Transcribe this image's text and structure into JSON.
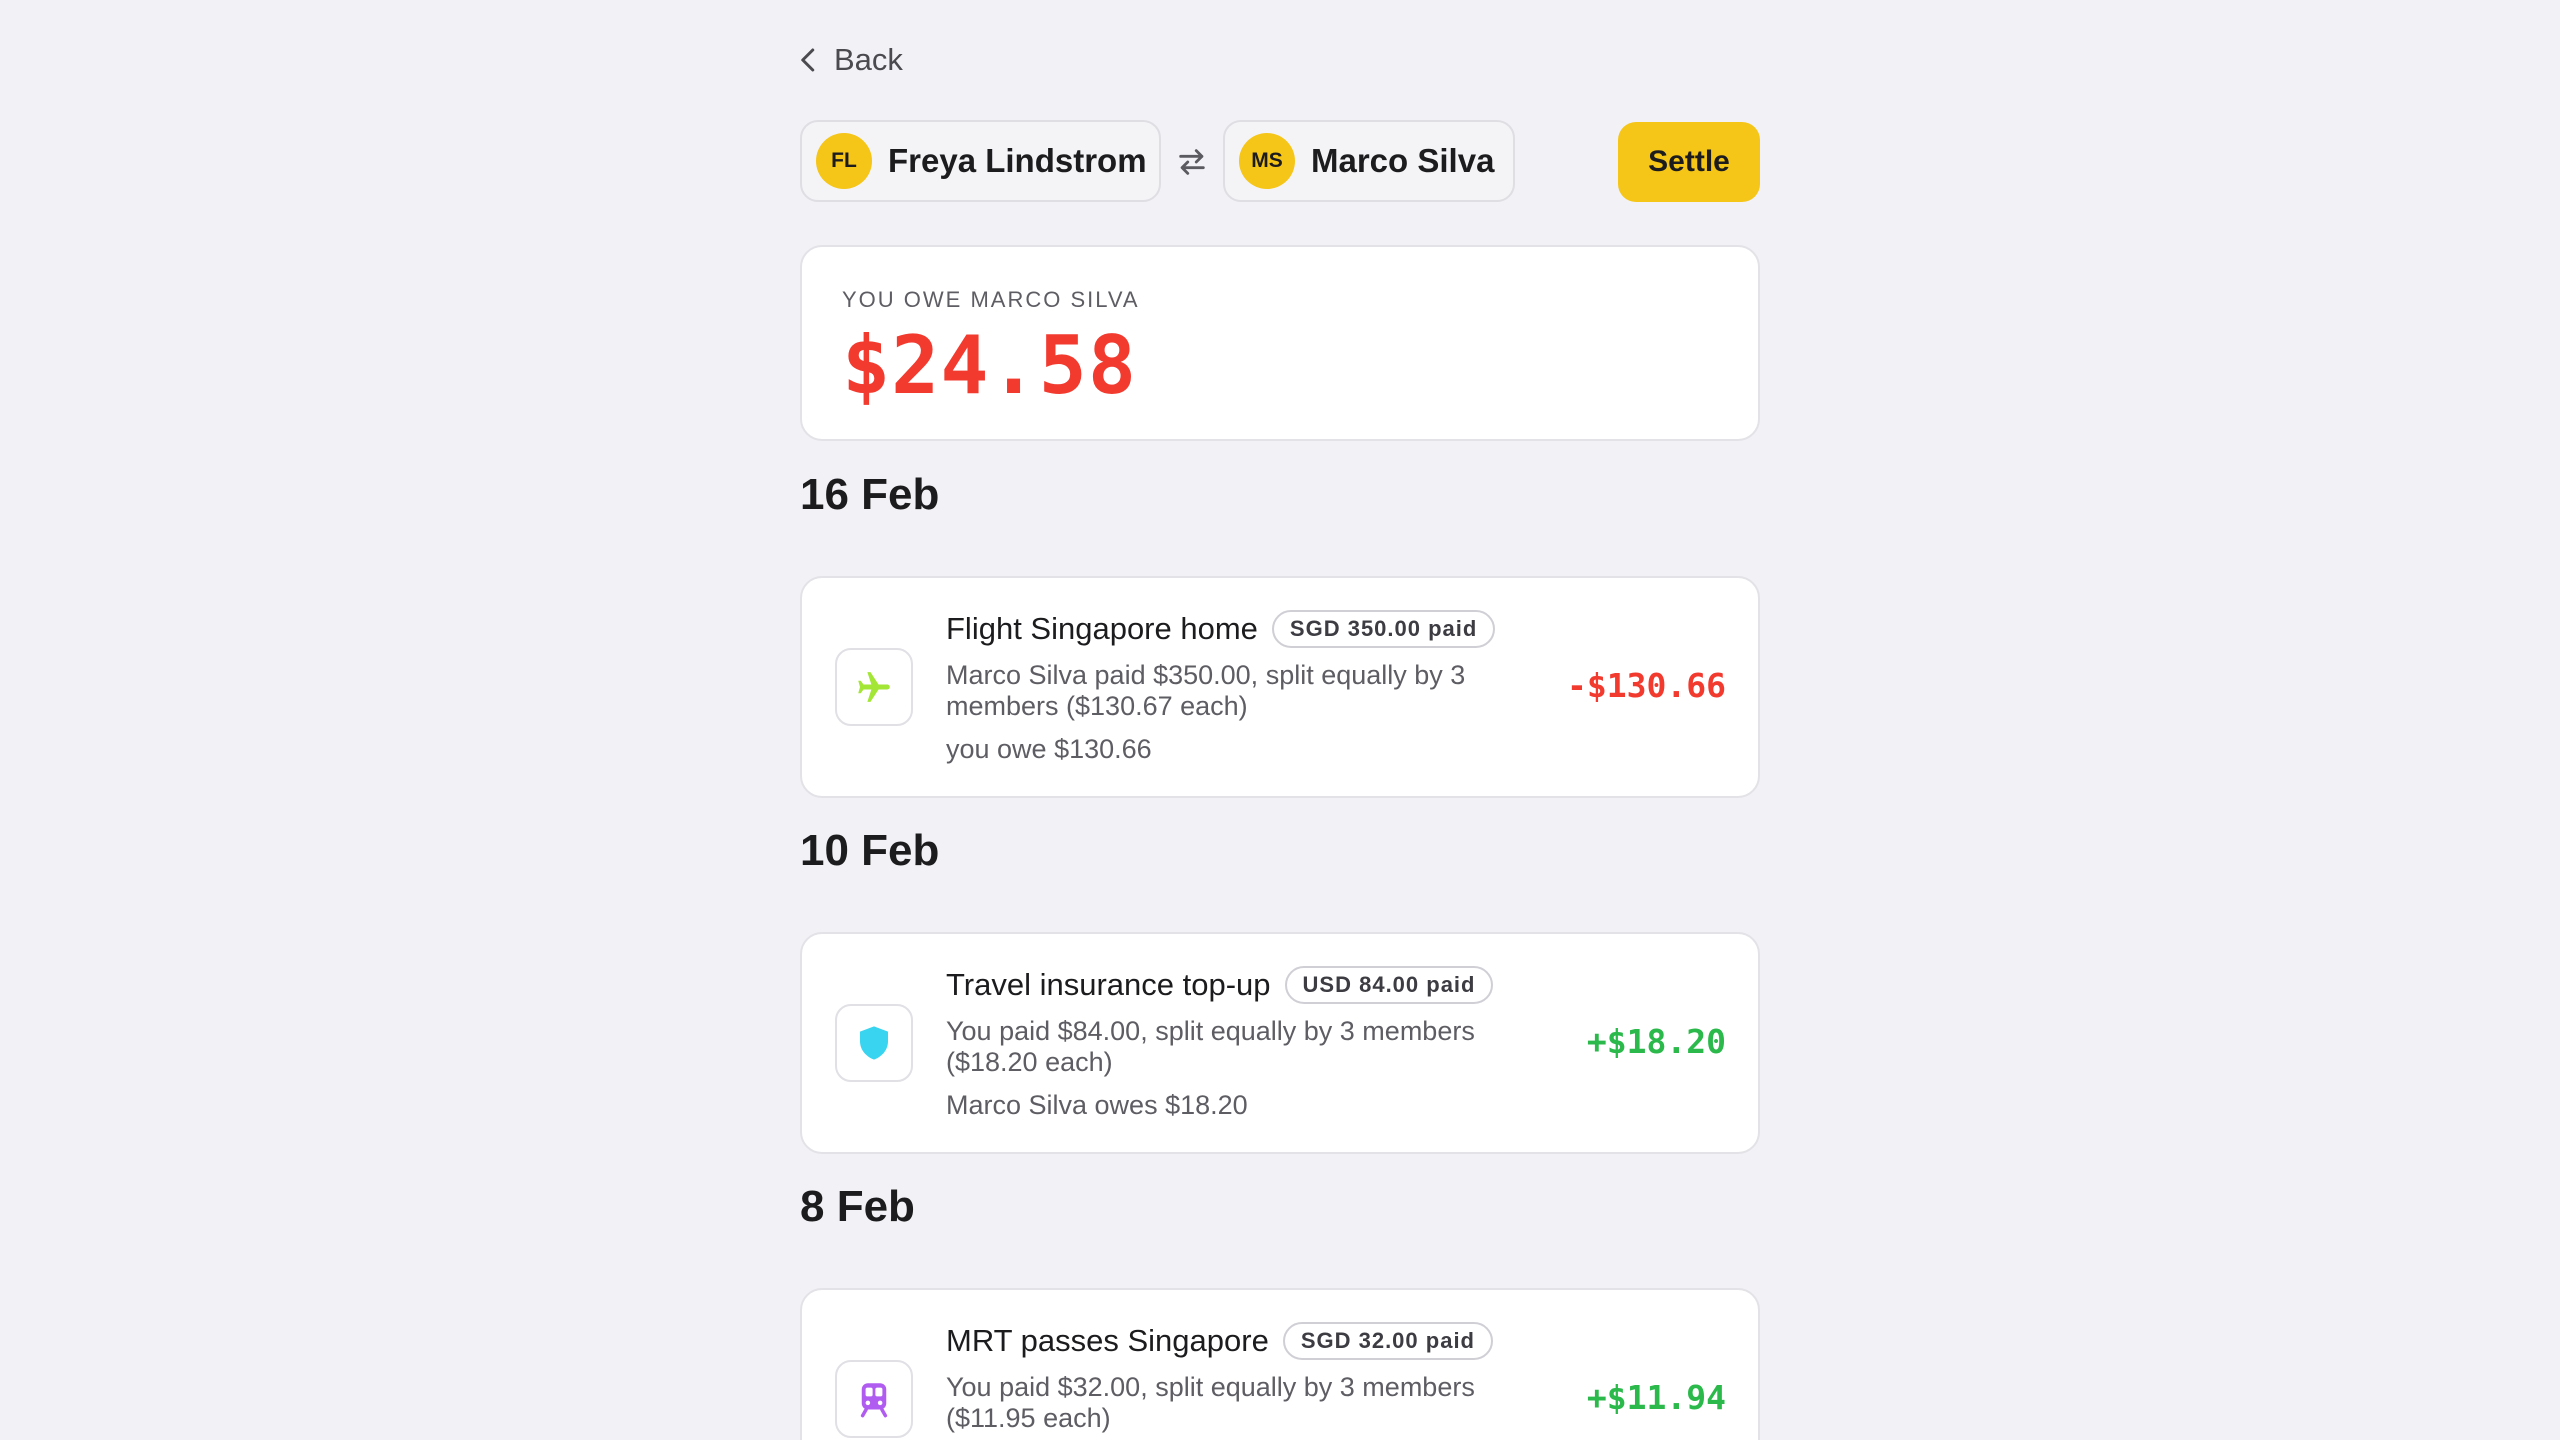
{
  "nav": {
    "back_label": "Back"
  },
  "header": {
    "from": {
      "initials": "FL",
      "name": "Freya Lindstrom"
    },
    "swap_icon": "arrows-exchange-icon",
    "to": {
      "initials": "MS",
      "name": "Marco Silva"
    },
    "settle_label": "Settle"
  },
  "balance": {
    "label": "YOU OWE MARCO SILVA",
    "amount": "$24.58",
    "color": "#f23a2f"
  },
  "groups": [
    {
      "date": "16 Feb",
      "expense": {
        "icon": "airplane-icon",
        "icon_color": "#a3e635",
        "title": "Flight Singapore home",
        "paid_badge": "SGD 350.00 paid",
        "description": "Marco Silva paid $350.00, split equally by 3 members ($130.67 each)",
        "share": "you owe $130.66",
        "amount": "-$130.66",
        "amount_color": "#f23a2f"
      }
    },
    {
      "date": "10 Feb",
      "expense": {
        "icon": "shield-icon",
        "icon_color": "#38d4f0",
        "title": "Travel insurance top-up",
        "paid_badge": "USD 84.00 paid",
        "description": "You paid $84.00, split equally by 3 members ($18.20 each)",
        "share": "Marco Silva owes $18.20",
        "amount": "+$18.20",
        "amount_color": "#2bb94b"
      }
    },
    {
      "date": "8 Feb",
      "expense": {
        "icon": "train-icon",
        "icon_color": "#b15cf0",
        "title": "MRT passes Singapore",
        "paid_badge": "SGD 32.00 paid",
        "description": "You paid $32.00, split equally by 3 members ($11.95 each)",
        "share": "",
        "amount": "+$11.94",
        "amount_color": "#2bb94b"
      }
    }
  ]
}
